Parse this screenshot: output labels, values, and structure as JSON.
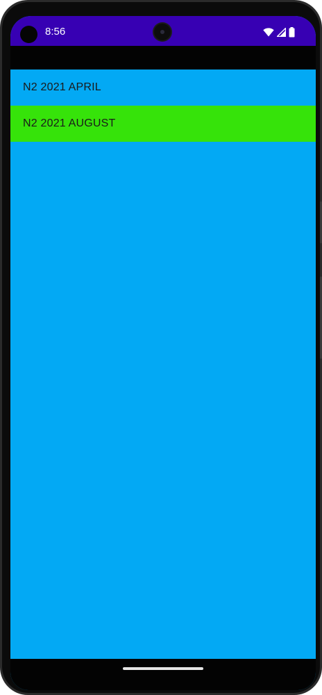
{
  "status_bar": {
    "time": "8:56",
    "background": "#3700b3",
    "icons": [
      "wifi-icon",
      "cellular-signal-icon",
      "battery-icon"
    ]
  },
  "toolbar": {
    "background": "#030303"
  },
  "list": {
    "background": "#03a9f4",
    "items": [
      {
        "label": "N2 2021 APRIL",
        "background": "#03a9f4",
        "selected": false
      },
      {
        "label": "N2 2021 AUGUST",
        "background": "#36e30a",
        "selected": true
      }
    ]
  },
  "nav_bar": {
    "background": "#030303"
  }
}
